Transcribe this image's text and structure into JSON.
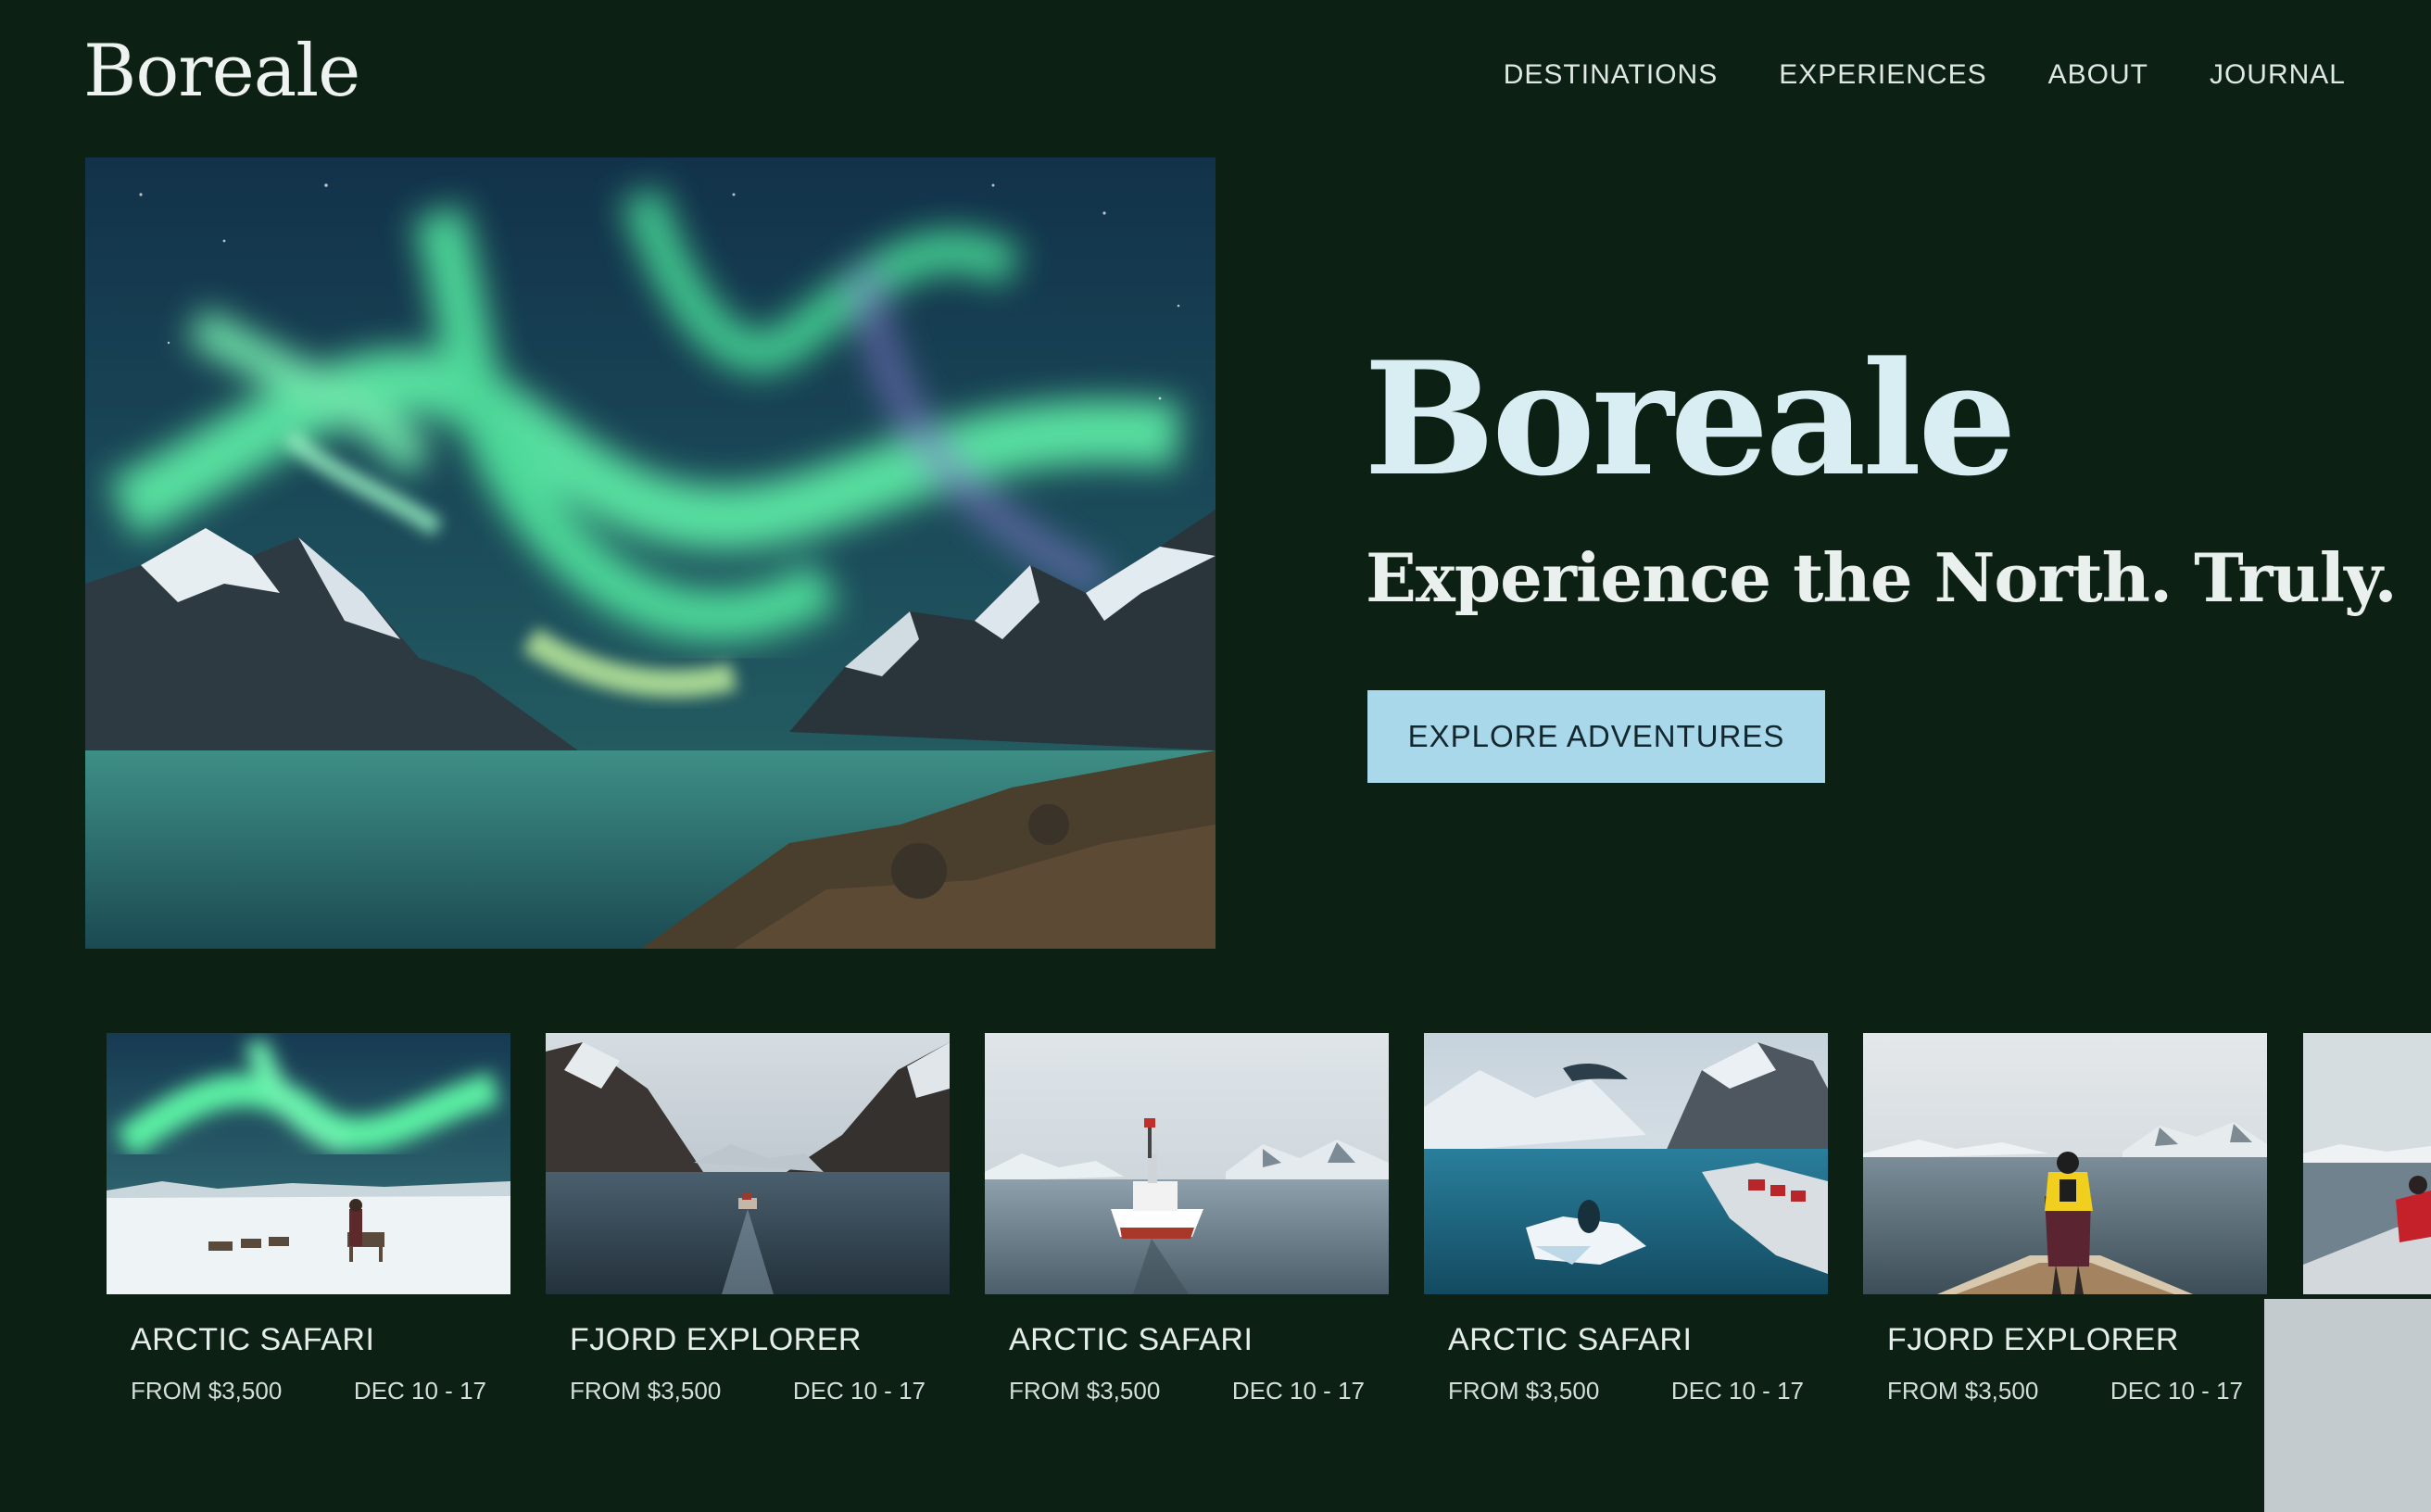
{
  "brand": {
    "logo": "Boreale"
  },
  "nav": {
    "items": [
      "DESTINATIONS",
      "EXPERIENCES",
      "ABOUT",
      "JOURNAL"
    ]
  },
  "hero": {
    "title": "Boreale",
    "subtitle": "Experience the North. Truly.",
    "cta_label": "EXPLORE ADVENTURES"
  },
  "cards": [
    {
      "title": "ARCTIC SAFARI",
      "price": "FROM $3,500",
      "dates": "DEC 10 - 17"
    },
    {
      "title": "FJORD EXPLORER",
      "price": "FROM $3,500",
      "dates": "DEC 10 - 17"
    },
    {
      "title": "ARCTIC SAFARI",
      "price": "FROM $3,500",
      "dates": "DEC 10 - 17"
    },
    {
      "title": "ARCTIC SAFARI",
      "price": "FROM $3,500",
      "dates": "DEC 10 - 17"
    },
    {
      "title": "FJORD EXPLORER",
      "price": "FROM $3,500",
      "dates": "DEC 10 - 17"
    }
  ],
  "colors": {
    "background": "#0c2014",
    "accent": "#a8d8ea",
    "headline": "#d8eef2"
  }
}
